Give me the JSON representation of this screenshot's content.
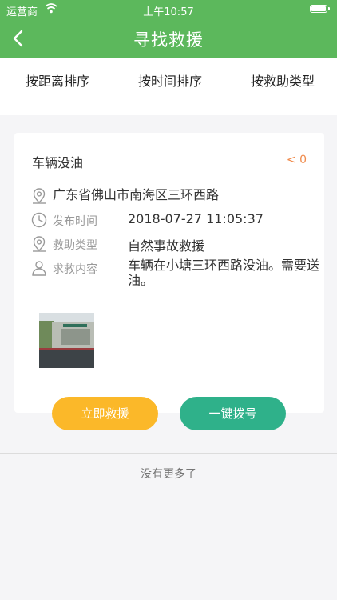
{
  "status_bar": {
    "carrier": "运营商",
    "time": "上午10:57"
  },
  "navbar": {
    "title": "寻找救援"
  },
  "sort_options": [
    "按距离排序",
    "按时间排序",
    "按救助类型"
  ],
  "card": {
    "title": "车辆没油",
    "distance": "< 0",
    "address": "广东省佛山市南海区三环西路",
    "publish_label": "发布时间",
    "publish_time": "2018-07-27 11:05:37",
    "type_label": "救助类型",
    "type_value": "自然事故救援",
    "content_label": "求救内容",
    "content_value": "车辆在小塘三环西路没油。需要送油。"
  },
  "actions": {
    "rescue_label": "立即救援",
    "call_label": "一键拨号"
  },
  "footer": {
    "no_more": "没有更多了"
  },
  "colors": {
    "brand_green": "#5cb85c",
    "accent_yellow": "#fbb829",
    "accent_teal": "#2fb18a",
    "distance_orange": "#f08a4b"
  }
}
